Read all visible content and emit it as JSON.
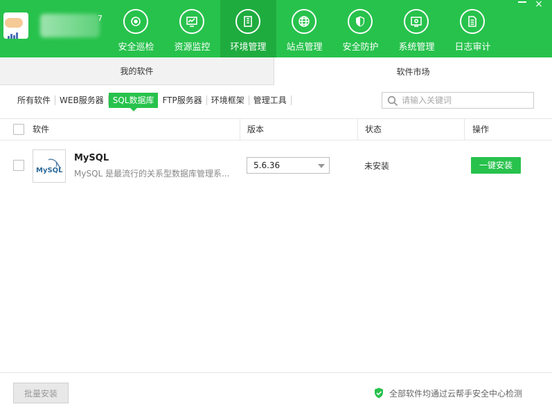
{
  "header": {
    "brand_suffix": "7",
    "nav": [
      {
        "label": "安全巡检",
        "icon": "patrol-icon",
        "active": false
      },
      {
        "label": "资源监控",
        "icon": "monitor-icon",
        "active": false
      },
      {
        "label": "环境管理",
        "icon": "server-icon",
        "active": true
      },
      {
        "label": "站点管理",
        "icon": "globe-icon",
        "active": false
      },
      {
        "label": "安全防护",
        "icon": "shield-icon",
        "active": false
      },
      {
        "label": "系统管理",
        "icon": "settings-icon",
        "active": false
      },
      {
        "label": "日志审计",
        "icon": "document-icon",
        "active": false
      }
    ],
    "close_glyph": "×"
  },
  "tabs": {
    "my_software": "我的软件",
    "market": "软件市场"
  },
  "categories": [
    "所有软件",
    "WEB服务器",
    "SQL数据库",
    "FTP服务器",
    "环境框架",
    "管理工具"
  ],
  "active_category": "SQL数据库",
  "search": {
    "placeholder": "请输入关键词"
  },
  "table": {
    "headers": {
      "software": "软件",
      "version": "版本",
      "status": "状态",
      "action": "操作"
    },
    "rows": [
      {
        "icon_text": "MySQL",
        "name": "MySQL",
        "description": "MySQL 是最流行的关系型数据库管理系...",
        "version": "5.6.36",
        "status": "未安装",
        "action": "一键安装"
      }
    ]
  },
  "footer": {
    "batch_install": "批量安装",
    "note": "全部软件均通过云帮手安全中心检测"
  },
  "colors": {
    "brand_green": "#27c24c",
    "active_nav": "#1fac3f"
  }
}
